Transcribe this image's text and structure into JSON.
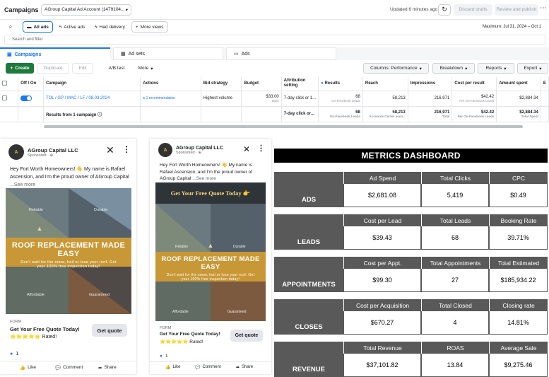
{
  "topbar": {
    "title": "Campaigns",
    "account": "AGroup Capital Ad Account (1479104...",
    "updated": "Updated 6 minutes ago",
    "discard": "Discard drafts",
    "review": "Review and publish"
  },
  "filters": {
    "pills": [
      "All ads",
      "Active ads",
      "Had delivery",
      "More views"
    ],
    "date_range": "Maximum: Jul 31, 2024 – Oct 1",
    "search_placeholder": "Search and filter"
  },
  "tabs": [
    "Campaigns",
    "Ad sets",
    "Ads"
  ],
  "toolbar": {
    "create": "Create",
    "duplicate": "Duplicate",
    "edit": "Edit",
    "abtest": "A/B test",
    "more": "More",
    "columns": "Columns: Performance",
    "breakdown": "Breakdown",
    "reports": "Reports",
    "export": "Export"
  },
  "table": {
    "headers": [
      "Off / On",
      "Campaign",
      "Actions",
      "Bid strategy",
      "Budget",
      "Attribution setting",
      "Results",
      "Reach",
      "Impressions",
      "Cost per result",
      "Amount spent",
      "E"
    ],
    "row": {
      "campaign": "TOL / GP / MAC / LF / 08.03.2024",
      "actions": "1 recommendation",
      "bid": "Highest volume",
      "budget": "$33.00",
      "budget_sub": "Daily",
      "attribution": "7-day click or 1...",
      "results": "68",
      "results_sub": "On-Facebook Leads",
      "reach": "58,213",
      "impressions": "216,971",
      "cpr": "$42.42",
      "cpr_sub": "Per On-Facebook Leads",
      "spent": "$2,884.34"
    },
    "total": {
      "label": "Results from 1 campaign",
      "attribution": "7-day click or...",
      "results": "68",
      "results_sub": "On-Facebook Leads",
      "reach": "58,213",
      "reach_sub": "Accounts Center acco...",
      "impressions": "216,971",
      "impressions_sub": "Total",
      "cpr": "$42.42",
      "cpr_sub": "Per On-Facebook Leads",
      "spent": "$2,884.34",
      "spent_sub": "Total Spent"
    }
  },
  "ad1": {
    "page": "AGroup Capital LLC",
    "sponsored": "Sponsored · ⊕",
    "text": "Hey Fort Worth Homeowners! 👋 My name is Rafael Ascension, and I'm the proud owner of AGroup Capital",
    "see_more": "...See more",
    "banner": "ROOF REPLACEMENT MADE EASY",
    "banner_sub": "Don't wait for the snow, hail or lose your roof. Get your 100% free inspection today!",
    "tags": [
      "Reliable",
      "Durable",
      "Affordable",
      "Guaranteed"
    ],
    "form_label": "FORM",
    "cta_title": "Get Your Free Quote Today!",
    "rated": "⭐⭐⭐⭐⭐ Rated!",
    "cta": "Get quote",
    "likes": "1",
    "actions": [
      "Like",
      "Comment",
      "Share"
    ]
  },
  "ad2": {
    "page": "AGroup Capital LLC",
    "sponsored": "Sponsored · ⊕",
    "text": "Hey Fort Worth Homeowners! 👋 My name is Rafael Ascension, and I'm the proud owner of AGroup Capital",
    "see_more": "...See more",
    "headline": "Get Your Free Quote Today 👉",
    "banner": "ROOF REPLACEMENT MADE EASY",
    "banner_sub": "Don't wait for the snow, hail or lose your roof. Get your 100% free inspection today!",
    "tags": [
      "Reliable",
      "Durable",
      "Affordable",
      "Guaranteed"
    ],
    "form_label": "FORM",
    "cta_title": "Get Your Free Quote Today!",
    "rated": "⭐⭐⭐⭐⭐ Rated!",
    "cta": "Get quote",
    "likes": "1",
    "actions": [
      "Like",
      "Comment",
      "Share"
    ]
  },
  "dashboard": {
    "title": "METRICS DASHBOARD",
    "sections": [
      {
        "label": "ADS",
        "headers": [
          "Ad Spend",
          "Total Clicks",
          "CPC"
        ],
        "values": [
          "$2,681.08",
          "5,419",
          "$0.49"
        ]
      },
      {
        "label": "LEADS",
        "headers": [
          "Cost per Lead",
          "Total Leads",
          "Booking Rate"
        ],
        "values": [
          "$39.43",
          "68",
          "39.71%"
        ]
      },
      {
        "label": "APPOINTMENTS",
        "headers": [
          "Cost per Appt.",
          "Total Appointments",
          "Total Estimated"
        ],
        "values": [
          "$99.30",
          "27",
          "$185,934.22"
        ]
      },
      {
        "label": "CLOSES",
        "headers": [
          "Cost per Acquisition",
          "Total Closed",
          "Closing rate"
        ],
        "values": [
          "$670.27",
          "4",
          "14.81%"
        ]
      },
      {
        "label": "REVENUE",
        "headers": [
          "Total Revenue",
          "ROAS",
          "Average Sale"
        ],
        "values": [
          "$37,101.82",
          "13.84",
          "$9,275.46"
        ]
      }
    ]
  },
  "colors": {
    "accent": "#1877f2",
    "create": "#1e7a3c",
    "dash_gray": "#595959",
    "banner_gold": "#c99836"
  }
}
